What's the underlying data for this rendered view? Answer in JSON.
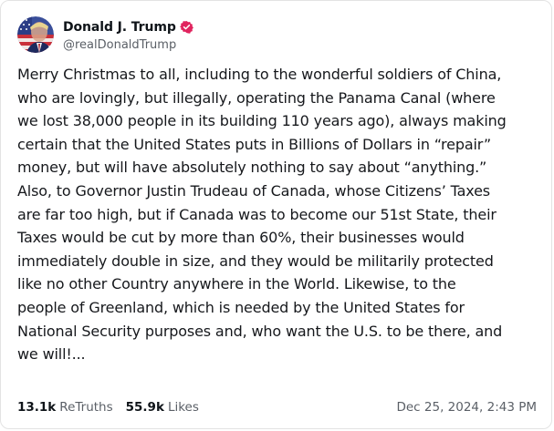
{
  "author": {
    "display_name": "Donald J. Trump",
    "handle": "@realDonaldTrump",
    "avatar_icon": "profile-photo-flag-icon",
    "verified_icon": "verified-badge-icon",
    "verified_color": "#e0245e"
  },
  "post": {
    "lines": [
      "Merry Christmas to all, including to the wonderful soldiers of China,",
      "who are lovingly, but illegally, operating the Panama Canal (where",
      "we lost 38,000 people in its building 110 years ago), always making",
      "certain that the United States puts in Billions of Dollars in “repair”",
      "money, but will have absolutely nothing to say about “anything.”",
      "Also, to Governor Justin Trudeau of Canada, whose Citizens’ Taxes",
      "are far too high, but if Canada was to become our 51st State, their",
      "Taxes would be cut by more than 60%, their businesses would",
      "immediately double in size, and they would be militarily protected",
      "like no other Country anywhere in the World. Likewise, to the",
      "people of Greenland, which is needed by the United States for",
      "National Security purposes and, who want the U.S. to be there, and",
      "we will!..."
    ]
  },
  "stats": {
    "retruths_count": "13.1k",
    "retruths_label": "ReTruths",
    "likes_count": "55.9k",
    "likes_label": "Likes"
  },
  "timestamp": "Dec 25, 2024, 2:43 PM"
}
